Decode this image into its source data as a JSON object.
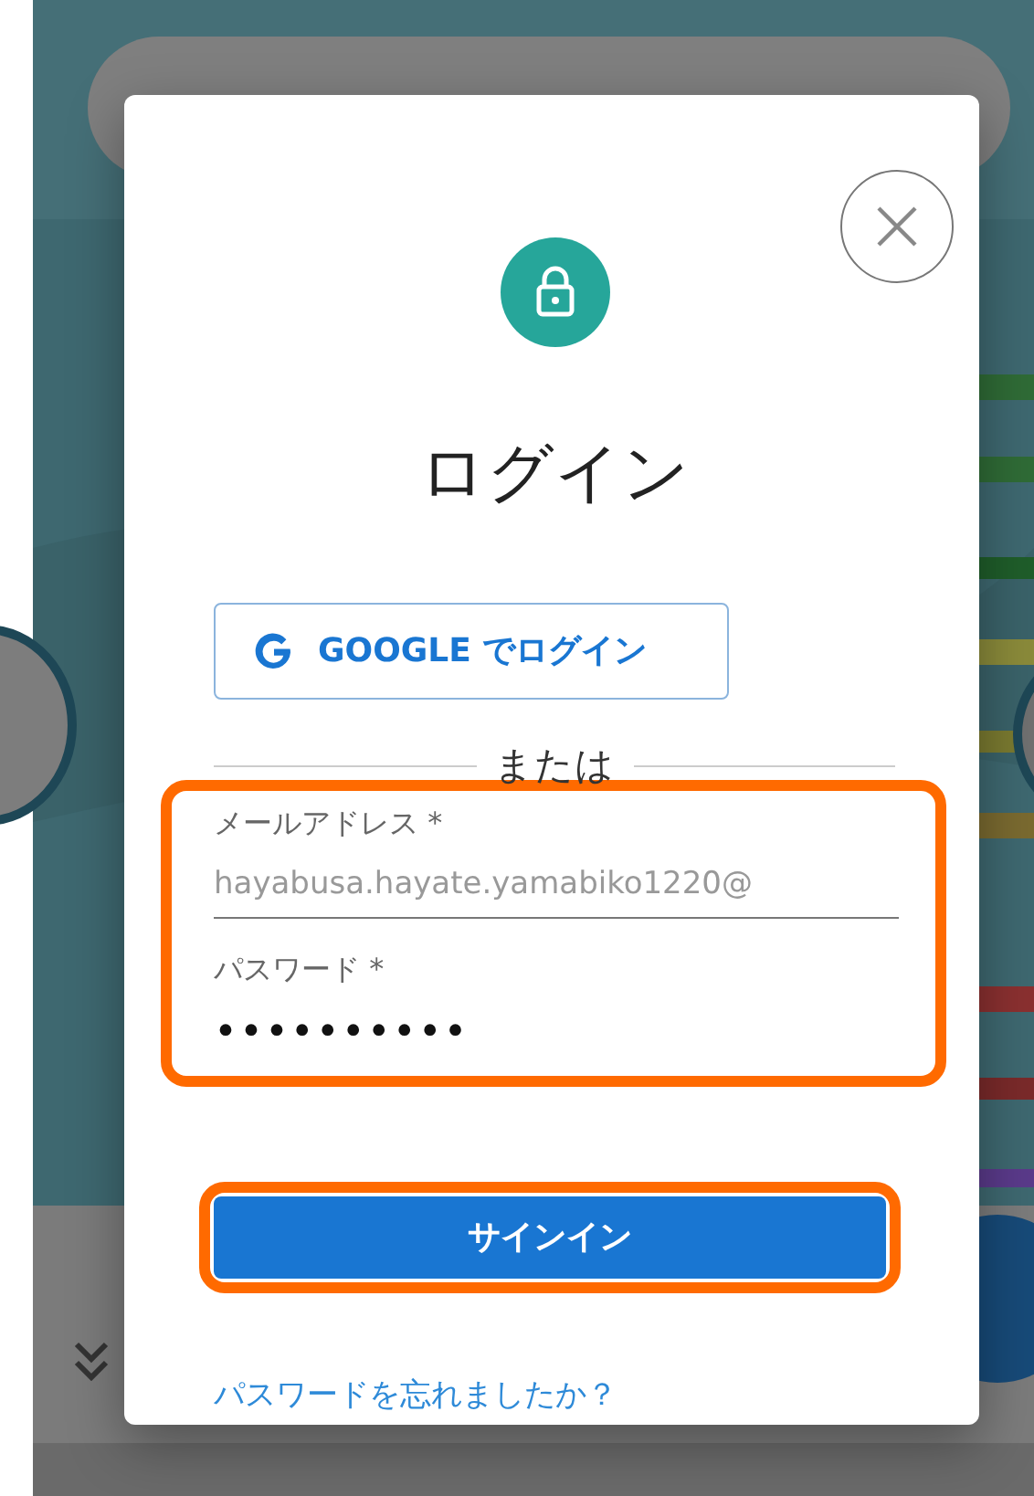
{
  "dialog": {
    "title": "ログイン",
    "google_button": {
      "label": "GOOGLE でログイン"
    },
    "divider": {
      "label": "または"
    },
    "form": {
      "highlighted": true,
      "fields": [
        {
          "kind": "email",
          "label": "メールアドレス *",
          "value": "hayabusa.hayate.yamabiko1220@"
        },
        {
          "kind": "password",
          "label": "パスワード *",
          "value": "••••••••••"
        }
      ]
    },
    "submit_button": {
      "label": "サインイン",
      "highlighted": true
    },
    "forgot_link": {
      "label": "パスワードを忘れましたか？"
    }
  }
}
